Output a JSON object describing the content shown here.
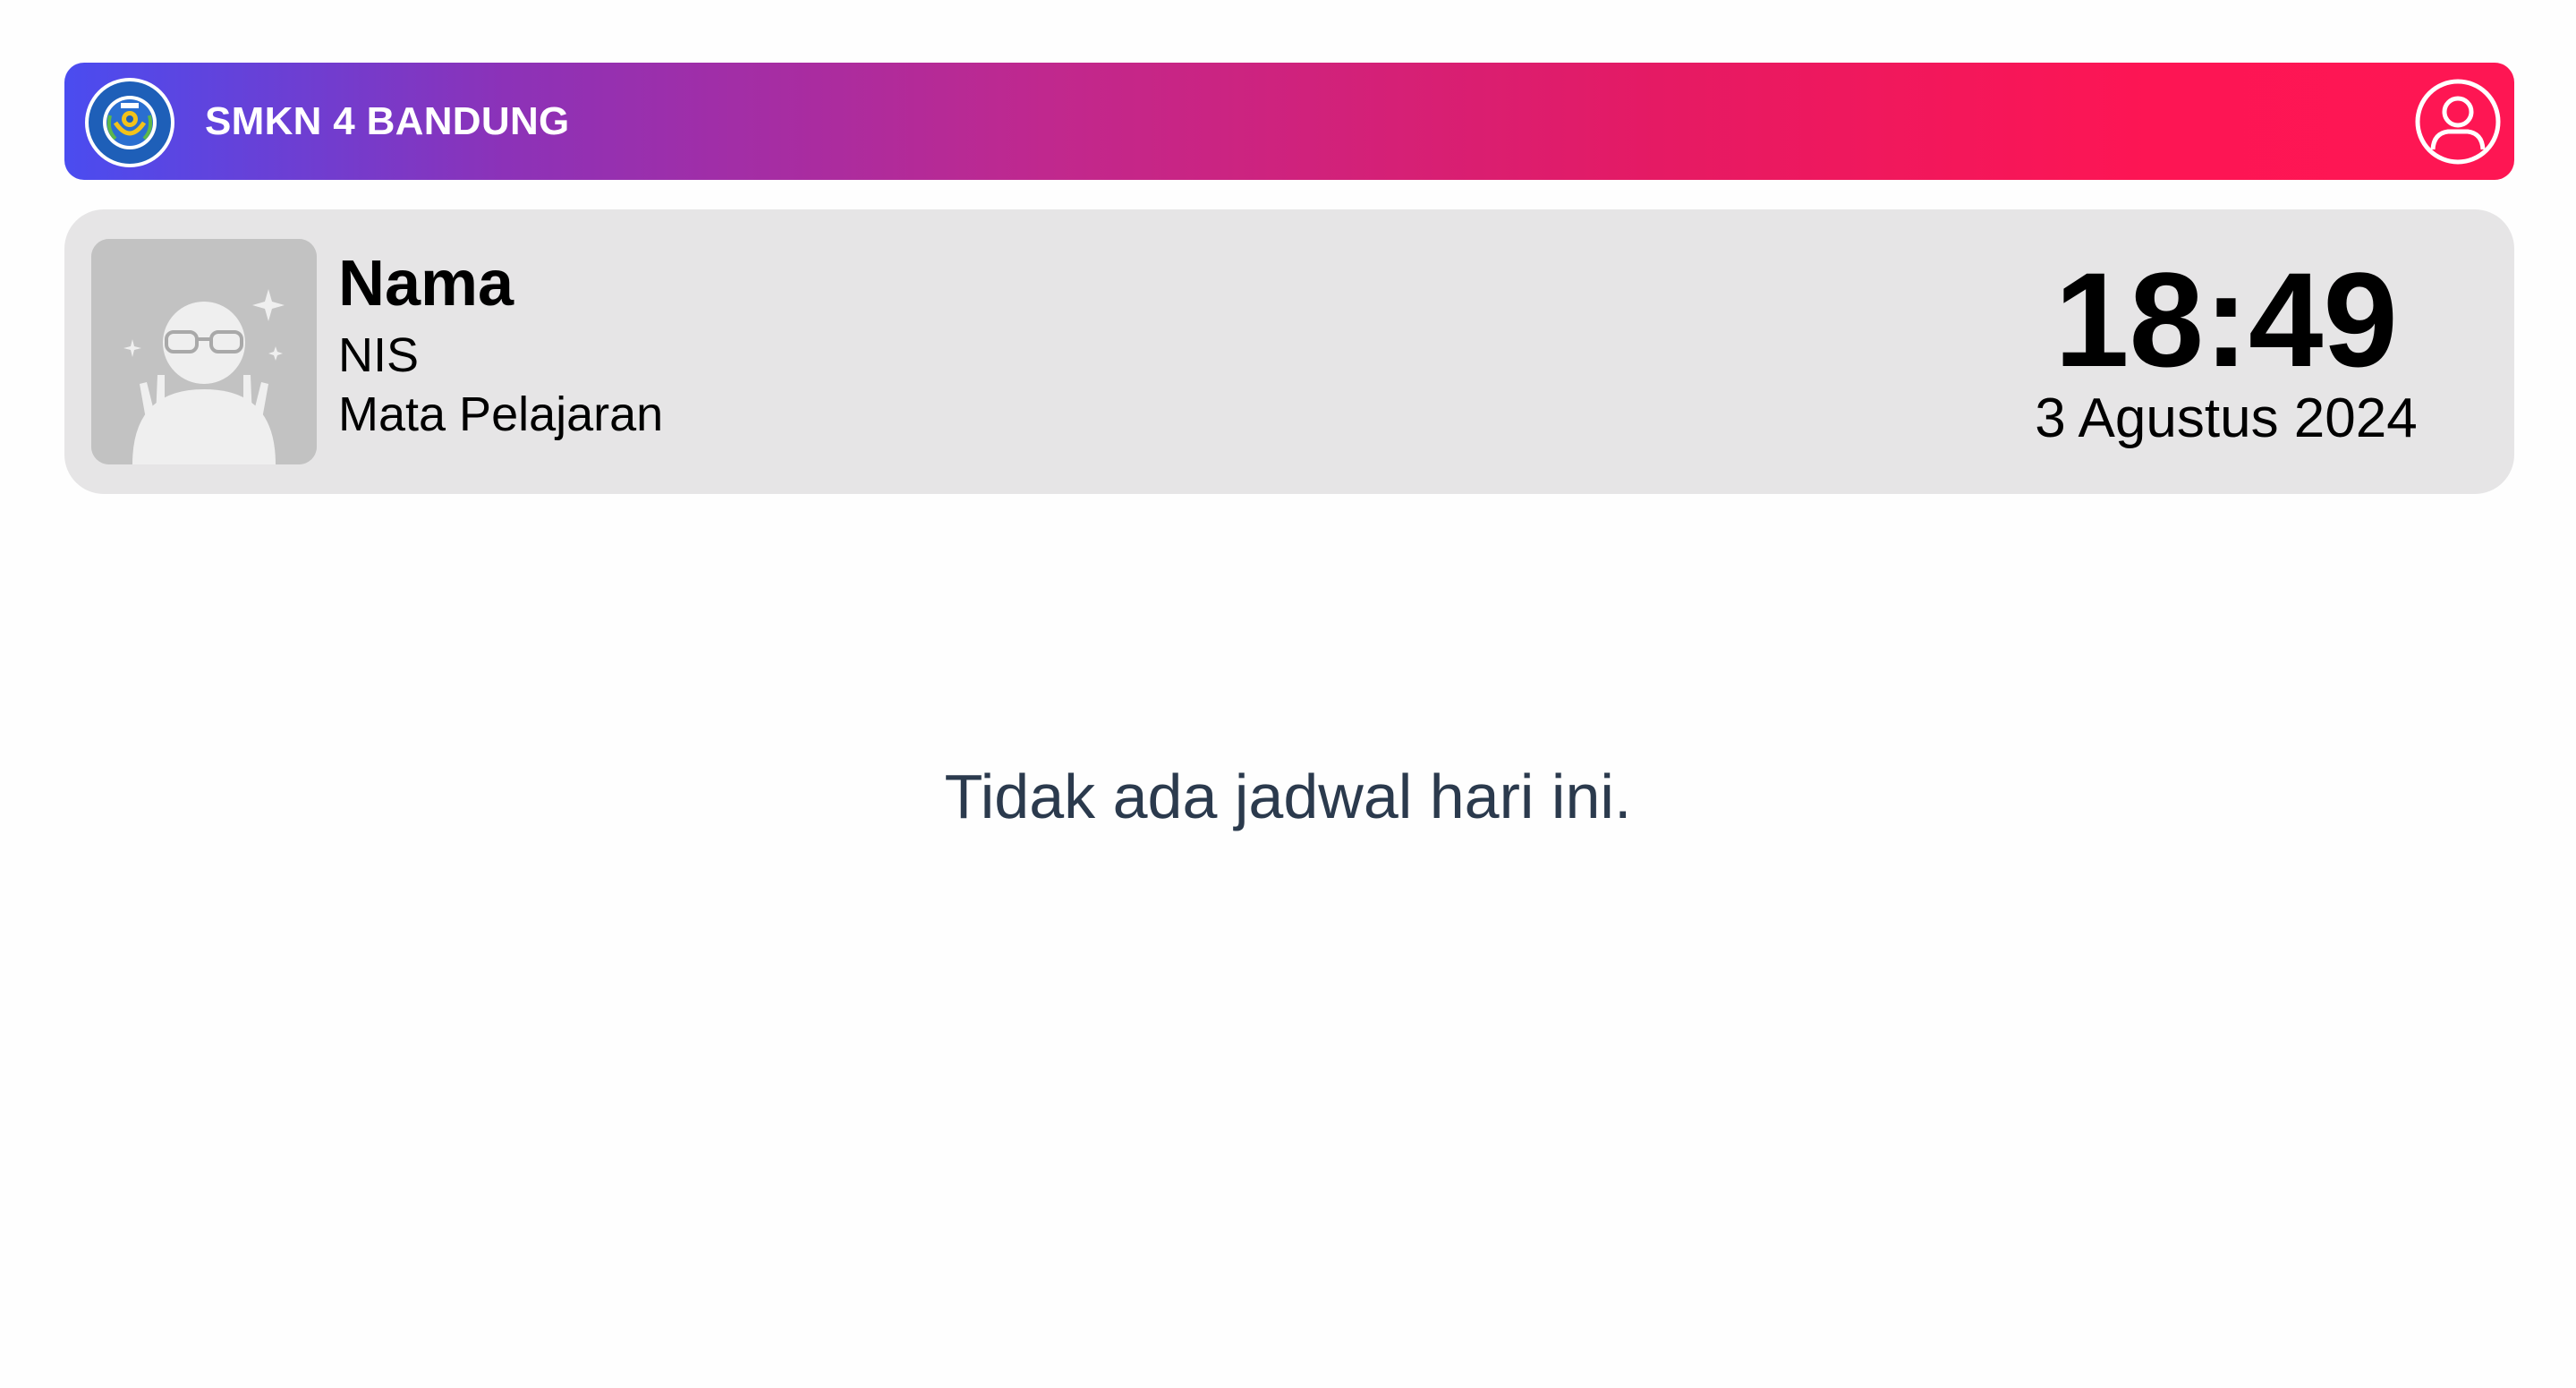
{
  "header": {
    "school_name": "SMKN 4 BANDUNG",
    "logo_icon": "school-crest-icon",
    "profile_icon": "user-circle-icon",
    "gradient_colors": [
      "#4a4cf0",
      "#c0288e",
      "#fe1653"
    ]
  },
  "student_card": {
    "name_label": "Nama",
    "nis_label": "NIS",
    "subject_label": "Mata Pelajaran",
    "avatar_icon": "default-avatar-icon",
    "background_color": "#e6e5e6"
  },
  "clock": {
    "time": "18:49",
    "date": "3 Agustus 2024"
  },
  "schedule": {
    "empty_message": "Tidak ada jadwal hari ini."
  }
}
